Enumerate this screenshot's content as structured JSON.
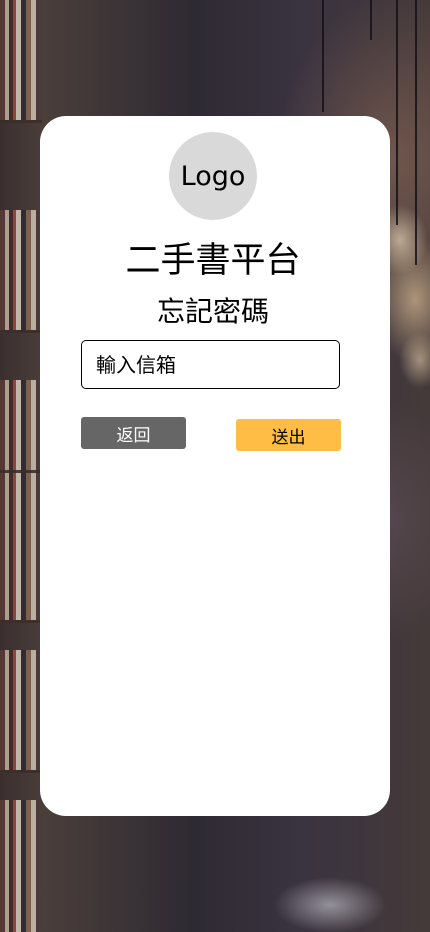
{
  "logo": {
    "text": "Logo"
  },
  "header": {
    "app_title": "二手書平台",
    "page_title": "忘記密碼"
  },
  "form": {
    "email_placeholder": "輸入信箱",
    "back_label": "返回",
    "submit_label": "送出"
  },
  "colors": {
    "card_background": "#ffffff",
    "logo_circle": "#d9d9d9",
    "back_button": "#666666",
    "submit_button": "#ffbd45"
  }
}
